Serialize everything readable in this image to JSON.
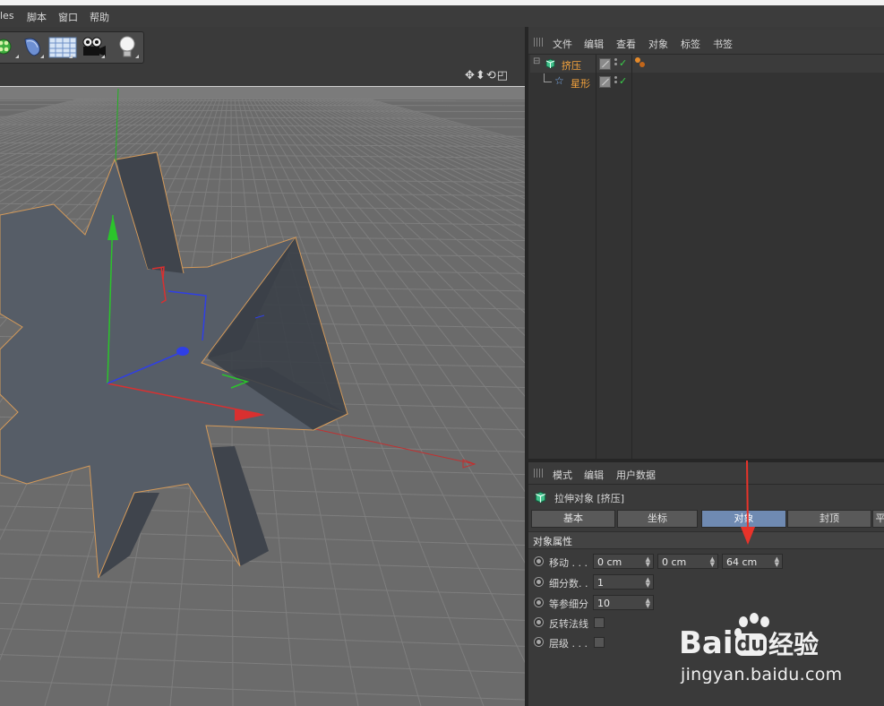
{
  "menubar": {
    "items": [
      "les",
      "脚本",
      "窗口",
      "帮助"
    ]
  },
  "toolbar": {
    "buttons": [
      "mograph-cloner-icon",
      "deformer-icon",
      "floor-icon",
      "camera-icon",
      "light-bulb-icon"
    ]
  },
  "viewport": {
    "nav_icons": [
      "move-view-icon",
      "dolly-view-icon",
      "rotate-view-icon",
      "maximize-view-icon"
    ]
  },
  "object_manager": {
    "menu": [
      "文件",
      "编辑",
      "查看",
      "对象",
      "标签",
      "书签"
    ],
    "objects": [
      {
        "name": "挤压",
        "icon": "extrude-icon",
        "color": "#f5a33c"
      },
      {
        "name": "星形",
        "icon": "star-spline-icon",
        "color": "#f5a33c"
      }
    ]
  },
  "attribute_manager": {
    "menu": [
      "模式",
      "编辑",
      "用户数据"
    ],
    "title": "拉伸对象 [挤压]",
    "tabs": [
      {
        "label": "基本",
        "active": false
      },
      {
        "label": "坐标",
        "active": false
      },
      {
        "label": "对象",
        "active": true
      },
      {
        "label": "封顶",
        "active": false
      },
      {
        "label": "平",
        "active": false
      }
    ],
    "section": "对象属性",
    "props": {
      "move_label": "移动 . . .",
      "move_x": "0 cm",
      "move_y": "0 cm",
      "move_z": "64 cm",
      "subdiv_label": "细分数. .",
      "subdiv_value": "1",
      "iso_label": "等参细分",
      "iso_value": "10",
      "flip_label": "反转法线",
      "flip_checked": false,
      "hier_label": "层级 . . .",
      "hier_checked": false
    }
  },
  "watermark": {
    "brand_a": "Bai",
    "brand_b": "du",
    "brand_c": "经验",
    "url": "jingyan.baidu.com"
  },
  "colors": {
    "accent_tab": "#6f8ab2",
    "object_name": "#f5a33c",
    "viewport": "#6b6b6b",
    "star_face": "#575e68",
    "star_side": "#3f444c",
    "axis_x": "#d93030",
    "axis_y": "#2bc42b",
    "axis_z": "#2f3fe6"
  }
}
